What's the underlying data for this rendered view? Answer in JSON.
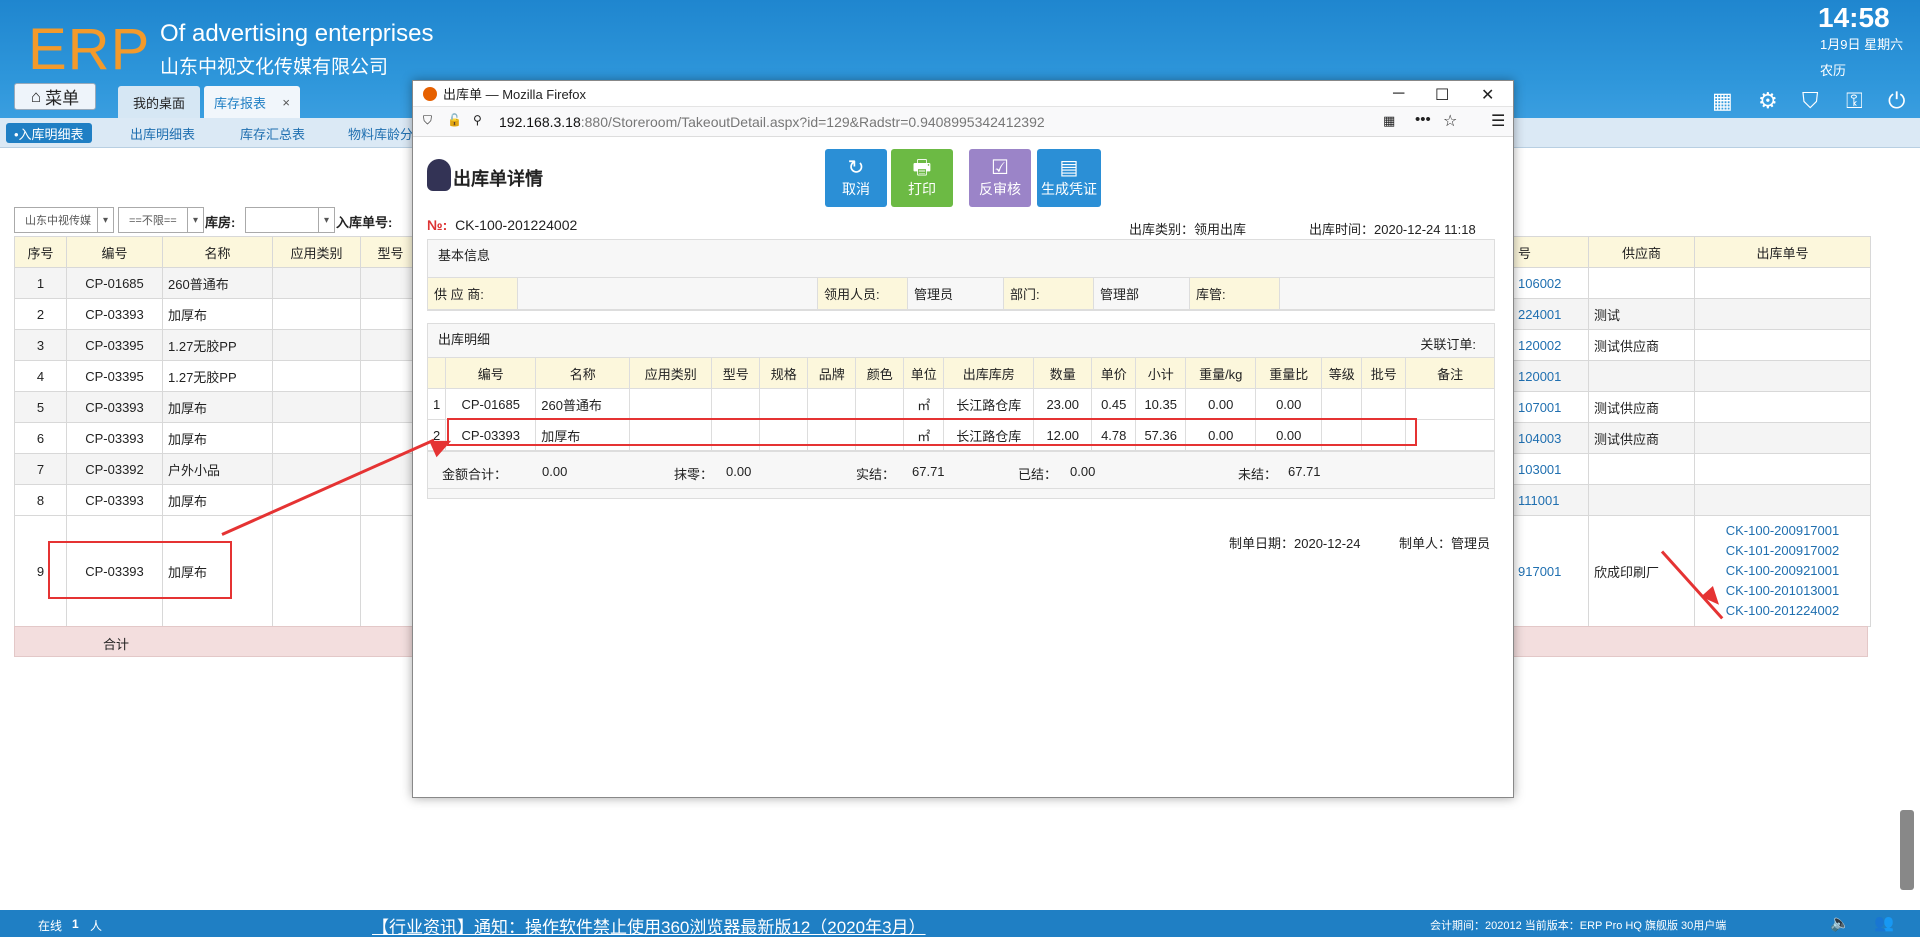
{
  "header": {
    "logo": "ERP",
    "subtitle_en": "Of advertising enterprises",
    "subtitle_cn": "山东中视文化传媒有限公司",
    "time": "14:58",
    "date": "1月9日 星期六",
    "lunar": "农历"
  },
  "menu": {
    "label": "菜单"
  },
  "tabs": [
    {
      "label": "我的桌面"
    },
    {
      "label": "库存报表",
      "close": "×"
    }
  ],
  "subnav": [
    {
      "label": "•入库明细表"
    },
    {
      "label": "出库明细表"
    },
    {
      "label": "库存汇总表"
    },
    {
      "label": "物料库龄分"
    }
  ],
  "filters": {
    "company": "山东中视传媒",
    "range": "==不限==",
    "warehouse_label": "库房:",
    "inbound_no_label": "入库单号:"
  },
  "bg_table": {
    "headers": [
      "序号",
      "编号",
      "名称",
      "应用类别",
      "型号"
    ],
    "rows": [
      [
        "1",
        "CP-01685",
        "260普通布"
      ],
      [
        "2",
        "CP-03393",
        "加厚布"
      ],
      [
        "3",
        "CP-03395",
        "1.27无胶PP"
      ],
      [
        "4",
        "CP-03395",
        "1.27无胶PP"
      ],
      [
        "5",
        "CP-03393",
        "加厚布"
      ],
      [
        "6",
        "CP-03393",
        "加厚布"
      ],
      [
        "7",
        "CP-03392",
        "户外小品"
      ],
      [
        "8",
        "CP-03393",
        "加厚布"
      ],
      [
        "9",
        "CP-03393",
        "加厚布"
      ]
    ],
    "total_label": "合计"
  },
  "bg_right": {
    "headers": [
      "号",
      "供应商",
      "出库单号"
    ],
    "rows": [
      [
        "106002",
        "",
        ""
      ],
      [
        "224001",
        "测试",
        ""
      ],
      [
        "120002",
        "测试供应商",
        ""
      ],
      [
        "120001",
        "",
        ""
      ],
      [
        "107001",
        "测试供应商",
        ""
      ],
      [
        "104003",
        "测试供应商",
        ""
      ],
      [
        "103001",
        "",
        ""
      ],
      [
        "111001",
        "",
        ""
      ]
    ],
    "row9": {
      "no": "917001",
      "supplier": "欣成印刷厂",
      "out_nos": [
        "CK-100-200917001",
        "CK-101-200917002",
        "CK-100-200921001",
        "CK-100-201013001",
        "CK-100-201224002"
      ]
    }
  },
  "status": {
    "online_label": "在线",
    "online_count": "1",
    "online_unit": "人",
    "news": "【行业资讯】通知：操作软件禁止使用360浏览器最新版12（2020年3月）",
    "period": "会计期间：202012  当前版本：ERP Pro HQ 旗舰版 30用户端"
  },
  "dialog": {
    "window_title": "出库单 — Mozilla Firefox",
    "url_host": "192.168.3.18",
    "url_rest": ":880/Storeroom/TakeoutDetail.aspx?id=129&Radstr=0.9408995342412392",
    "page_title": "出库单详情",
    "buttons": [
      {
        "label": "取消",
        "icon": "↻",
        "color": "#2b8fd6"
      },
      {
        "label": "打印",
        "icon": "🖶",
        "color": "#6cba44"
      },
      {
        "label": "反审核",
        "icon": "☑",
        "color": "#9b84c8"
      },
      {
        "label": "生成凭证",
        "icon": "▤",
        "color": "#2b8fd6"
      }
    ],
    "no_label": "№:",
    "no_value": "CK-100-201224002",
    "out_type": "出库类别：领用出库",
    "out_time": "出库时间：2020-12-24 11:18",
    "basic_title": "基本信息",
    "info": {
      "supplier_label": "供 应 商:",
      "supplier": "",
      "receiver_label": "领用人员:",
      "receiver": "管理员",
      "dept_label": "部门:",
      "dept": "管理部",
      "keeper_label": "库管:",
      "keeper": ""
    },
    "detail_title": "出库明细",
    "related_label": "关联订单:",
    "detail_headers": [
      "",
      "编号",
      "名称",
      "应用类别",
      "型号",
      "规格",
      "品牌",
      "颜色",
      "单位",
      "出库库房",
      "数量",
      "单价",
      "小计",
      "重量/kg",
      "重量比",
      "等级",
      "批号",
      "备注"
    ],
    "detail_rows": [
      [
        "1",
        "CP-01685",
        "260普通布",
        "",
        "",
        "",
        "",
        "",
        "㎡",
        "长江路仓库",
        "23.00",
        "0.45",
        "10.35",
        "0.00",
        "0.00",
        "",
        "",
        ""
      ],
      [
        "2",
        "CP-03393",
        "加厚布",
        "",
        "",
        "",
        "",
        "",
        "㎡",
        "长江路仓库",
        "12.00",
        "4.78",
        "57.36",
        "0.00",
        "0.00",
        "",
        "",
        ""
      ]
    ],
    "totals": {
      "amount_label": "金额合计：",
      "amount": "0.00",
      "rounding_label": "抹零：",
      "rounding": "0.00",
      "settled_label": "实结：",
      "settled": "67.71",
      "paid_label": "已结：",
      "paid": "0.00",
      "unpaid_label": "未结：",
      "unpaid": "67.71"
    },
    "make_date": "制单日期：2020-12-24",
    "maker": "制单人：管理员"
  }
}
